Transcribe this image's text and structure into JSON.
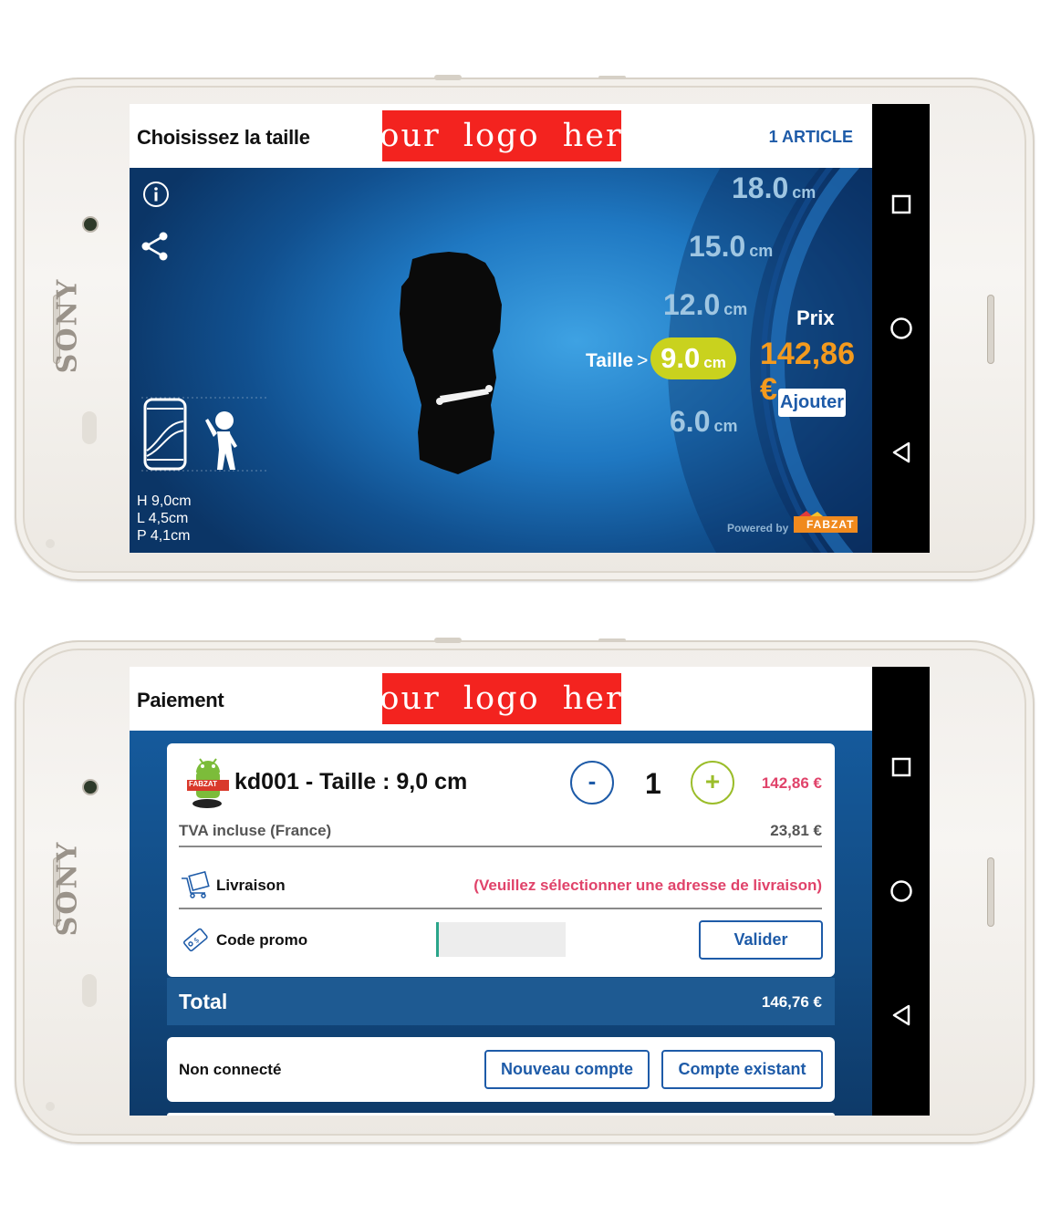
{
  "screen1": {
    "header": {
      "title": "Choisissez la taille",
      "logo": "your logo here",
      "cart": "1 ARTICLE"
    },
    "sizes": [
      {
        "value": "18.0",
        "unit": "cm"
      },
      {
        "value": "15.0",
        "unit": "cm"
      },
      {
        "value": "12.0",
        "unit": "cm"
      },
      {
        "value": "6.0",
        "unit": "cm"
      }
    ],
    "selected_size": {
      "label": "Taille",
      "value": "9.0",
      "unit": "cm"
    },
    "price": {
      "label": "Prix",
      "value": "142,86 €"
    },
    "add_button": "Ajouter",
    "dimensions": [
      "H 9,0cm",
      "L 4,5cm",
      "P 4,1cm"
    ],
    "powered_by": "Powered by",
    "powered_brand": "FABZAT",
    "icons": [
      "info-icon",
      "share-icon",
      "soda-can-icon",
      "person-icon"
    ]
  },
  "screen2": {
    "header": {
      "title": "Paiement",
      "logo": "your logo here"
    },
    "item": {
      "name": "kd001 - Taille : 9,0 cm",
      "quantity": "1",
      "minus": "-",
      "plus": "+",
      "price": "142,86 €",
      "tax_label": "TVA incluse (France)",
      "tax_value": "23,81 €",
      "thumb_badge": "FABZAT"
    },
    "delivery": {
      "label": "Livraison",
      "message": "(Veuillez sélectionner une adresse de livraison)"
    },
    "promo": {
      "label": "Code promo",
      "value": "",
      "button": "Valider"
    },
    "total": {
      "label": "Total",
      "value": "146,76 €"
    },
    "account": {
      "status": "Non connecté",
      "new_button": "Nouveau compte",
      "existing_button": "Compte existant"
    }
  },
  "device": {
    "brand": "SONY"
  },
  "colors": {
    "logo_bg": "#f3231f",
    "accent_blue": "#1e5ba8",
    "price_orange": "#f39a1e",
    "size_pill": "#c9d21e",
    "alert_pink": "#e0436a",
    "plus_green": "#9bbd2a"
  }
}
